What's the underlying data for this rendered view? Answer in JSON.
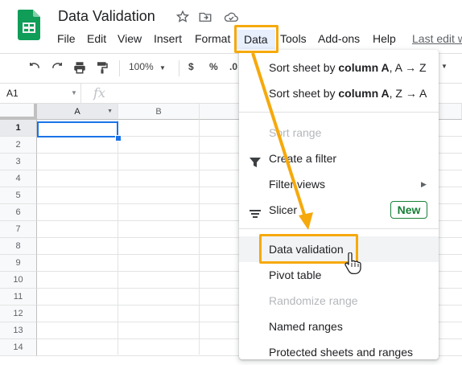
{
  "title_bar": {
    "doc_title": "Data Validation",
    "icons": [
      "star-icon",
      "move-to-folder-icon",
      "cloud-status-icon"
    ]
  },
  "menubar": {
    "items": [
      "File",
      "Edit",
      "View",
      "Insert",
      "Format",
      "Data",
      "Tools",
      "Add-ons",
      "Help"
    ],
    "last_edit": "Last edit w"
  },
  "toolbar": {
    "zoom": "100%",
    "currency": "$",
    "percent": "%",
    "decimal": ".0"
  },
  "formula_bar": {
    "name_box": "A1",
    "fx_label": "fx"
  },
  "grid": {
    "columns": [
      "A",
      "B"
    ],
    "rows": [
      "1",
      "2",
      "3",
      "4",
      "5",
      "6",
      "7",
      "8",
      "9",
      "10",
      "11",
      "12",
      "13",
      "14"
    ],
    "active_cell": "A1"
  },
  "data_menu": {
    "items": [
      {
        "prefix": "Sort sheet by ",
        "bold": "column A",
        "suffix": ", A → Z",
        "disabled": false
      },
      {
        "prefix": "Sort sheet by ",
        "bold": "column A",
        "suffix": ", Z → A",
        "disabled": false
      },
      {
        "label": "Sort range",
        "disabled": true
      },
      {
        "label": "Create a filter",
        "icon": "filter-icon",
        "disabled": false
      },
      {
        "label": "Filter views",
        "submenu": true,
        "disabled": false
      },
      {
        "label": "Slicer",
        "icon": "slicer-icon",
        "badge": "New",
        "disabled": false
      },
      {
        "label": "Data validation",
        "disabled": false,
        "highlighted": true
      },
      {
        "label": "Pivot table",
        "disabled": false
      },
      {
        "label": "Randomize range",
        "disabled": true
      },
      {
        "label": "Named ranges",
        "disabled": false
      },
      {
        "label": "Protected sheets and ranges",
        "disabled": false
      }
    ]
  },
  "colors": {
    "annotation": "#f6a90b",
    "accent": "#1a73e8",
    "new_badge": "#188038",
    "sheets_green": "#0f9d58"
  }
}
